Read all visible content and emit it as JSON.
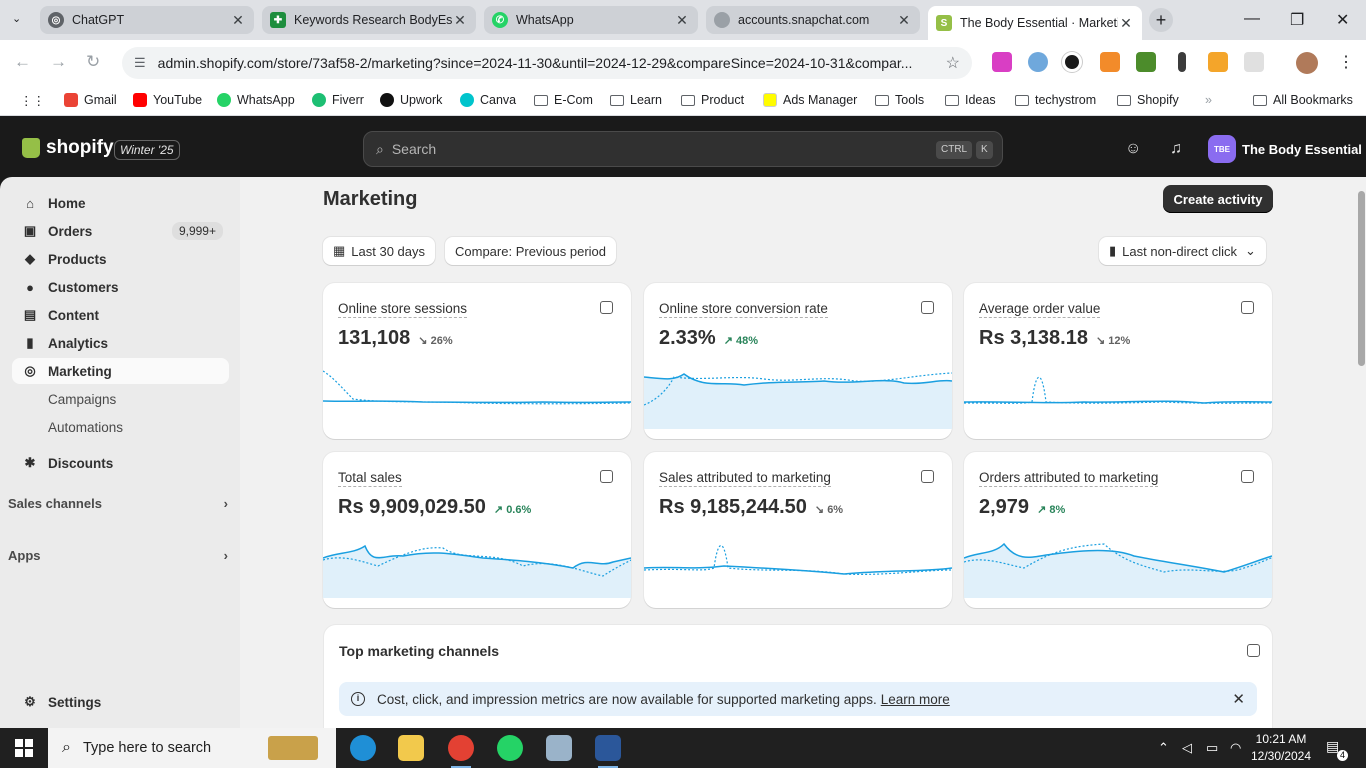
{
  "browser": {
    "tabs": [
      {
        "label": "ChatGPT",
        "color": "#5f6368",
        "active": false
      },
      {
        "label": "Keywords Research BodyEssen",
        "color": "#1e8e3e",
        "active": false
      },
      {
        "label": "WhatsApp",
        "color": "#25d366",
        "active": false
      },
      {
        "label": "accounts.snapchat.com",
        "color": "#9aa0a6",
        "active": false
      },
      {
        "label": "The Body Essential · Marketin",
        "color": "#95bf47",
        "active": true
      }
    ],
    "url": "admin.shopify.com/store/73af58-2/marketing?since=2024-11-30&until=2024-12-29&compareSince=2024-10-31&compar...",
    "bookmarks": [
      {
        "label": "Gmail",
        "type": "site",
        "color": "#ea4335"
      },
      {
        "label": "YouTube",
        "type": "site",
        "color": "#ff0000"
      },
      {
        "label": "WhatsApp",
        "type": "site",
        "color": "#25d366"
      },
      {
        "label": "Fiverr",
        "type": "site",
        "color": "#1dbf73"
      },
      {
        "label": "Upwork",
        "type": "site",
        "color": "#111111"
      },
      {
        "label": "Canva",
        "type": "site",
        "color": "#00c4cc"
      },
      {
        "label": "E-Com",
        "type": "folder"
      },
      {
        "label": "Learn",
        "type": "folder"
      },
      {
        "label": "Product",
        "type": "folder"
      },
      {
        "label": "Ads Manager",
        "type": "site",
        "color": "#fffc00"
      },
      {
        "label": "Tools",
        "type": "folder"
      },
      {
        "label": "Ideas",
        "type": "folder"
      },
      {
        "label": "techystrom",
        "type": "folder"
      },
      {
        "label": "Shopify",
        "type": "folder"
      }
    ],
    "all_bookmarks": "All Bookmarks"
  },
  "shopify": {
    "brand": "shopify",
    "edition": "Winter '25",
    "search_placeholder": "Search",
    "kbd_ctrl": "CTRL",
    "kbd_k": "K",
    "store_initials": "TBE",
    "store_name": "The Body Essential"
  },
  "sidebar": {
    "items": [
      {
        "label": "Home",
        "icon": "home-icon",
        "glyph": "⌂"
      },
      {
        "label": "Orders",
        "icon": "orders-icon",
        "glyph": "▣",
        "badge": "9,999+"
      },
      {
        "label": "Products",
        "icon": "tag-icon",
        "glyph": "◆"
      },
      {
        "label": "Customers",
        "icon": "person-icon",
        "glyph": "●"
      },
      {
        "label": "Content",
        "icon": "content-icon",
        "glyph": "▤"
      },
      {
        "label": "Analytics",
        "icon": "bar-chart-icon",
        "glyph": "▮"
      },
      {
        "label": "Marketing",
        "icon": "marketing-icon",
        "glyph": "◎",
        "active": true
      }
    ],
    "sub_items": [
      "Campaigns",
      "Automations"
    ],
    "discounts": "Discounts",
    "sales_channels": "Sales channels",
    "apps": "Apps",
    "settings": "Settings"
  },
  "main": {
    "title": "Marketing",
    "create_button": "Create activity",
    "date_range": "Last 30 days",
    "compare": "Compare: Previous period",
    "attribution": "Last non-direct click",
    "metrics": [
      {
        "title": "Online store sessions",
        "value": "131,108",
        "delta": "26%",
        "direction": "down"
      },
      {
        "title": "Online store conversion rate",
        "value": "2.33%",
        "delta": "48%",
        "direction": "up"
      },
      {
        "title": "Average order value",
        "value": "Rs 3,138.18",
        "delta": "12%",
        "direction": "down"
      },
      {
        "title": "Total sales",
        "value": "Rs 9,909,029.50",
        "delta": "0.6%",
        "direction": "up"
      },
      {
        "title": "Sales attributed to marketing",
        "value": "Rs 9,185,244.50",
        "delta": "6%",
        "direction": "down"
      },
      {
        "title": "Orders attributed to marketing",
        "value": "2,979",
        "delta": "8%",
        "direction": "up"
      }
    ],
    "channels_title": "Top marketing channels",
    "banner_text": "Cost, click, and impression metrics are now available for supported marketing apps.",
    "banner_link": "Learn more",
    "colors": {
      "accent": "#1a9fe0",
      "up": "#29845a",
      "down": "#616161"
    }
  },
  "taskbar": {
    "search_placeholder": "Type here to search",
    "time": "10:21 AM",
    "date": "12/30/2024",
    "notifications": "4"
  }
}
